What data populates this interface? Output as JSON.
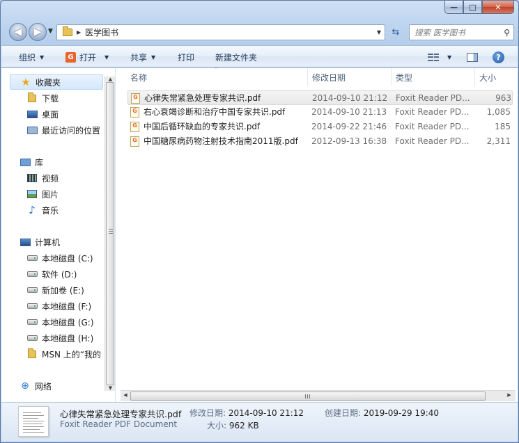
{
  "window": {
    "caption": {
      "minimize": "—",
      "maximize": "□",
      "close": "✕"
    }
  },
  "address": {
    "path": "医学图书",
    "search_placeholder": "搜索 医学图书"
  },
  "toolbar": {
    "organize": "组织",
    "open": "打开",
    "share": "共享",
    "print": "打印",
    "new_folder": "新建文件夹"
  },
  "nav": {
    "favorites": "收藏夹",
    "downloads": "下载",
    "desktop": "桌面",
    "recent": "最近访问的位置",
    "libraries": "库",
    "videos": "视频",
    "pictures": "图片",
    "music": "音乐",
    "computer": "计算机",
    "drive_c": "本地磁盘 (C:)",
    "drive_d": "软件 (D:)",
    "drive_e": "新加卷 (E:)",
    "drive_f": "本地磁盘 (F:)",
    "drive_g": "本地磁盘 (G:)",
    "drive_h": "本地磁盘 (H:)",
    "msn": "MSN 上的“我的",
    "network": "网络"
  },
  "columns": {
    "name": "名称",
    "date": "修改日期",
    "type": "类型",
    "size": "大小"
  },
  "files": [
    {
      "name": "心律失常紧急处理专家共识.pdf",
      "date": "2014-09-10 21:12",
      "type": "Foxit Reader PD...",
      "size": "963"
    },
    {
      "name": "右心衰竭诊断和治疗中国专家共识.pdf",
      "date": "2014-09-10 21:13",
      "type": "Foxit Reader PD...",
      "size": "1,085"
    },
    {
      "name": "中国后循环缺血的专家共识.pdf",
      "date": "2014-09-22 21:46",
      "type": "Foxit Reader PD...",
      "size": "185"
    },
    {
      "name": "中国糖尿病药物注射技术指南2011版.pdf",
      "date": "2012-09-13 16:38",
      "type": "Foxit Reader PD...",
      "size": "2,311"
    }
  ],
  "details": {
    "name": "心律失常紧急处理专家共识.pdf",
    "type": "Foxit Reader PDF Document",
    "modified_label": "修改日期:",
    "modified_value": "2014-09-10 21:12",
    "created_label": "创建日期:",
    "created_value": "2019-09-29 19:40",
    "size_label": "大小:",
    "size_value": "962 KB"
  }
}
